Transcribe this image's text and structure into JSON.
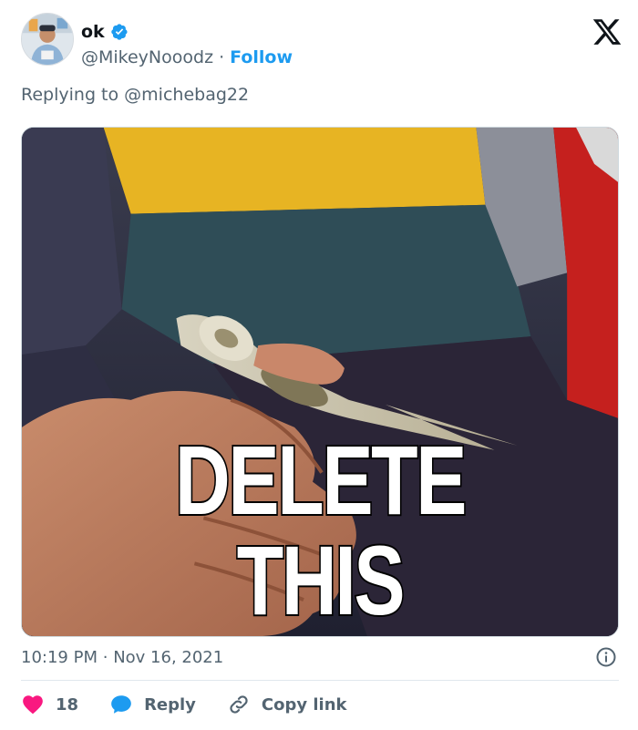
{
  "user": {
    "display_name": "ok",
    "handle": "@MikeyNooodz",
    "separator": "·",
    "follow_label": "Follow"
  },
  "reply": {
    "prefix": "Replying to",
    "mention": "@michebag22"
  },
  "media": {
    "caption": "DELETE THIS"
  },
  "meta": {
    "time": "10:19 PM",
    "separator": "·",
    "date": "Nov 16, 2021"
  },
  "actions": {
    "like_count": "18",
    "reply_label": "Reply",
    "copy_label": "Copy link"
  },
  "colors": {
    "accent": "#1d9bf0",
    "like": "#f91880",
    "text_secondary": "#536471"
  },
  "icons": {
    "brand": "x-logo-icon",
    "verified": "verified-badge-icon",
    "info": "info-icon",
    "like": "heart-icon",
    "reply": "speech-bubble-icon",
    "copy": "link-icon"
  }
}
